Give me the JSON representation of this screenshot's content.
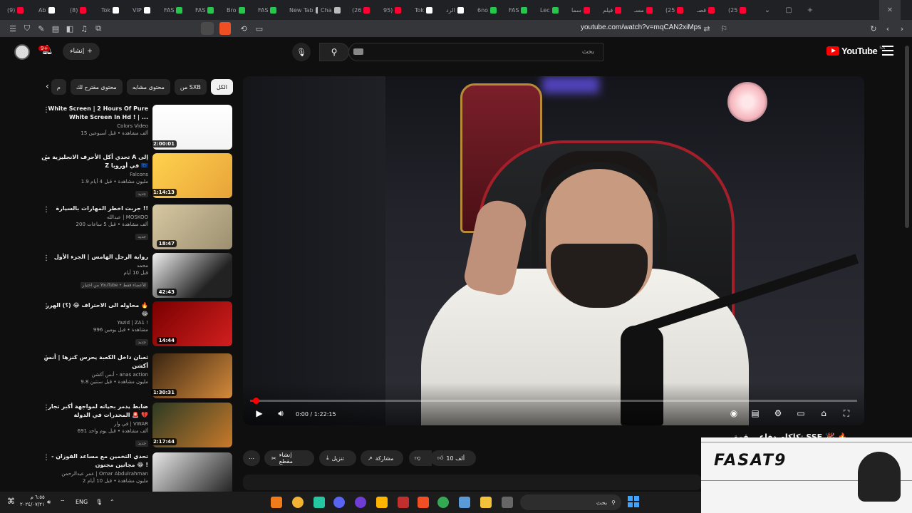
{
  "browser": {
    "tabs": [
      {
        "label": "(9)",
        "color": "#ff0033"
      },
      {
        "label": "Ab",
        "color": "#ffffff"
      },
      {
        "label": "(8)",
        "color": "#ff0033"
      },
      {
        "label": "Tok",
        "color": "#ffffff"
      },
      {
        "label": "VIP",
        "color": "#ffffff"
      },
      {
        "label": "FAS",
        "color": "#25c74f"
      },
      {
        "label": "FAS",
        "color": "#25c74f"
      },
      {
        "label": "Bro",
        "color": "#25c74f"
      },
      {
        "label": "FAS",
        "color": "#25c74f"
      },
      {
        "label": "New Tab",
        "color": "#bbbbbb"
      },
      {
        "label": "Cha",
        "color": "#bbbbbb"
      },
      {
        "label": "(26",
        "color": "#ff0033"
      },
      {
        "label": "95)",
        "color": "#ff0033"
      },
      {
        "label": "Tok",
        "color": "#ffffff"
      },
      {
        "label": "الرد",
        "color": "#ffffff"
      },
      {
        "label": "6no",
        "color": "#25c74f"
      },
      {
        "label": "FAS",
        "color": "#25c74f"
      },
      {
        "label": "Lec",
        "color": "#25c74f"
      },
      {
        "label": "سما",
        "color": "#ff0033"
      },
      {
        "label": "فيلم",
        "color": "#ff0033"
      },
      {
        "label": "مسـ",
        "color": "#ff0033"
      },
      {
        "label": "(25",
        "color": "#ff0033"
      },
      {
        "label": "قصـ",
        "color": "#ff0033"
      },
      {
        "label": "(25",
        "color": "#ff0033"
      }
    ],
    "url": "youtube.com/watch?v=mqCAN2xiMps"
  },
  "header": {
    "notifications_badge": "9+",
    "create_label": "إنشاء",
    "search_placeholder": "بحث",
    "logo_text": "YouTube",
    "logo_region": "SA"
  },
  "chips": {
    "items": [
      "الكل",
      "من SXB",
      "محتوى مشابه",
      "محتوى مقترح لك",
      "م"
    ]
  },
  "recommendations": [
    {
      "title": "White Screen | 2 Hours Of Pure White Screen In Hd ! | ...",
      "channel": "Colors Video",
      "meta": "15 ألف مشاهدة • قبل أسبوعين",
      "duration": "2:00:01",
      "badge": ""
    },
    {
      "title": "تحدي أكل الأحرف الانجليزية من A إلى Z في أوروبا 🇪🇺",
      "channel": "Falcons",
      "meta": "1.9 مليون مشاهدة • قبل 4 أيام",
      "duration": "1:14:13",
      "badge": "جديد"
    },
    {
      "title": "جربت اخطر المهارات بالسيارة !!",
      "channel": "عبدالله | MOSKOO",
      "meta": "200 ألف مشاهدة • قبل 5 ساعات",
      "duration": "18:47",
      "badge": "جديد"
    },
    {
      "title": "رواية الرجل الهامس | الجزء الأول",
      "channel": "محمد",
      "meta": "قبل 10 أيام",
      "duration": "42:43",
      "badge": "من اختيار YouTube • للأعضاء فقط"
    },
    {
      "title": "محاوله الى الاحتراف 😂 (؟) الهرر 🔥 😂",
      "channel": "Yazid | ZA1 !",
      "meta": "996 مشاهدة • قبل يومين",
      "duration": "14:44",
      "badge": "جديد"
    },
    {
      "title": "ثعبان داخل الكعبة يحرس كنزها | أنس أكشن",
      "channel": "أنس أكشن - anas action",
      "meta": "9.8 مليون مشاهدة • قبل سنتين",
      "duration": "1:30:31",
      "badge": ""
    },
    {
      "title": "ضابط يدمر بحياته لمواجهة أكبر تجار المخدرات في الدولة 🚨 💔",
      "channel": "في وار | VWAR",
      "meta": "691 ألف مشاهدة • قبل يوم واحد",
      "duration": "2:17:44",
      "badge": "جديد"
    },
    {
      "title": "تحدي التخمين مع مساعد الفوزان - مجانين مجنون 😂 !",
      "channel": "عمر عبدالرحمن | Omar Abdulrahman",
      "meta": "2 مليون مشاهدة • قبل 10 أيام",
      "duration": "",
      "badge": ""
    }
  ],
  "player": {
    "time": "0:00 / 1:22:15",
    "progress_fraction": 0.005
  },
  "video": {
    "title": "تكلكام دفاعي قوة SSF 🎉 🔥",
    "actions": {
      "likes": "10 ألف",
      "share": "مشاركة",
      "download": "تنزيل",
      "clip": "إنشاء مقطع"
    }
  },
  "overlay": {
    "brand": "FASAT9"
  },
  "taskbar": {
    "time": "٦:٥٥ م",
    "date": "٢٠٢٤/٠٧/٢١",
    "lang": "ENG",
    "search_label": "بحث"
  },
  "colors": {
    "accent": "#ff0000",
    "background": "#0f0f0f",
    "surface": "#272727"
  }
}
